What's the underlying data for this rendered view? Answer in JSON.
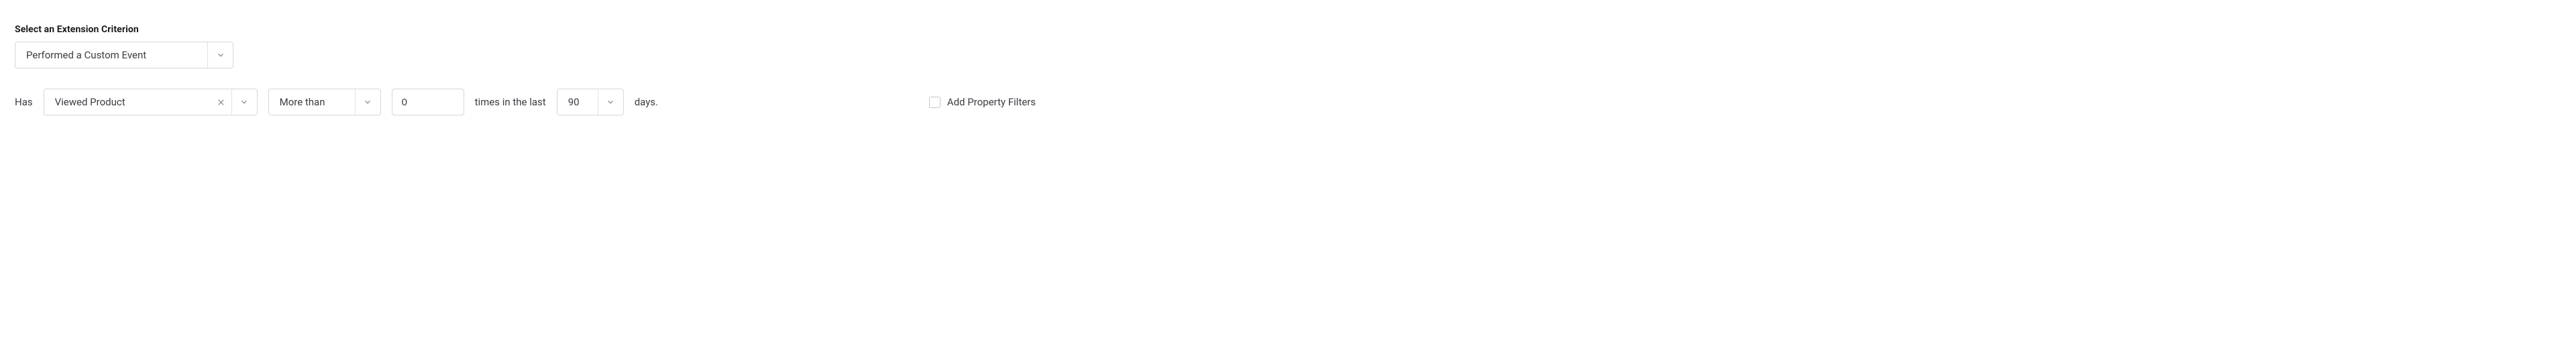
{
  "section_label": "Select an Extension Criterion",
  "criterion": {
    "value": "Performed a Custom Event"
  },
  "row": {
    "has_label": "Has",
    "event": {
      "value": "Viewed Product"
    },
    "comparator": {
      "value": "More than"
    },
    "count": {
      "value": "0"
    },
    "times_label": "times in the last",
    "days": {
      "value": "90"
    },
    "days_label": "days."
  },
  "add_filters_label": "Add Property Filters"
}
